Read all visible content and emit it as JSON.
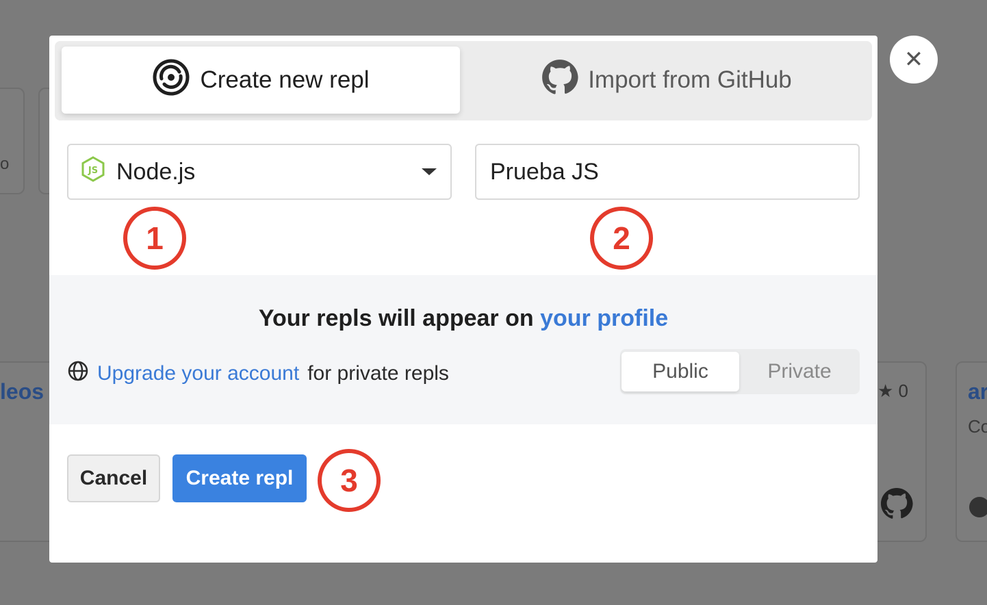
{
  "background": {
    "left_card_fragment": "o",
    "card_link_fragment": "leos",
    "star_count": "0",
    "right_card_title_fragment": "ar",
    "right_card_desc_fragment": "Co"
  },
  "tabs": [
    {
      "label": "Create new repl",
      "icon": "replit-logo-icon",
      "active": true
    },
    {
      "label": "Import from GitHub",
      "icon": "github-icon",
      "active": false
    }
  ],
  "language_select": {
    "value": "Node.js",
    "icon": "nodejs-icon"
  },
  "repl_name_input": {
    "value": "Prueba JS"
  },
  "markers": [
    "1",
    "2",
    "3"
  ],
  "visibility_info": {
    "title_prefix": "Your repls will appear on",
    "title_link": "your profile",
    "upgrade_link": "Upgrade your account",
    "upgrade_suffix": "for private repls",
    "options": [
      "Public",
      "Private"
    ],
    "selected": "Public"
  },
  "actions": {
    "cancel": "Cancel",
    "create": "Create repl"
  },
  "close_icon": "close-icon",
  "colors": {
    "primary": "#3a82e0",
    "marker": "#e43b2c",
    "link": "#3a7ad6"
  }
}
